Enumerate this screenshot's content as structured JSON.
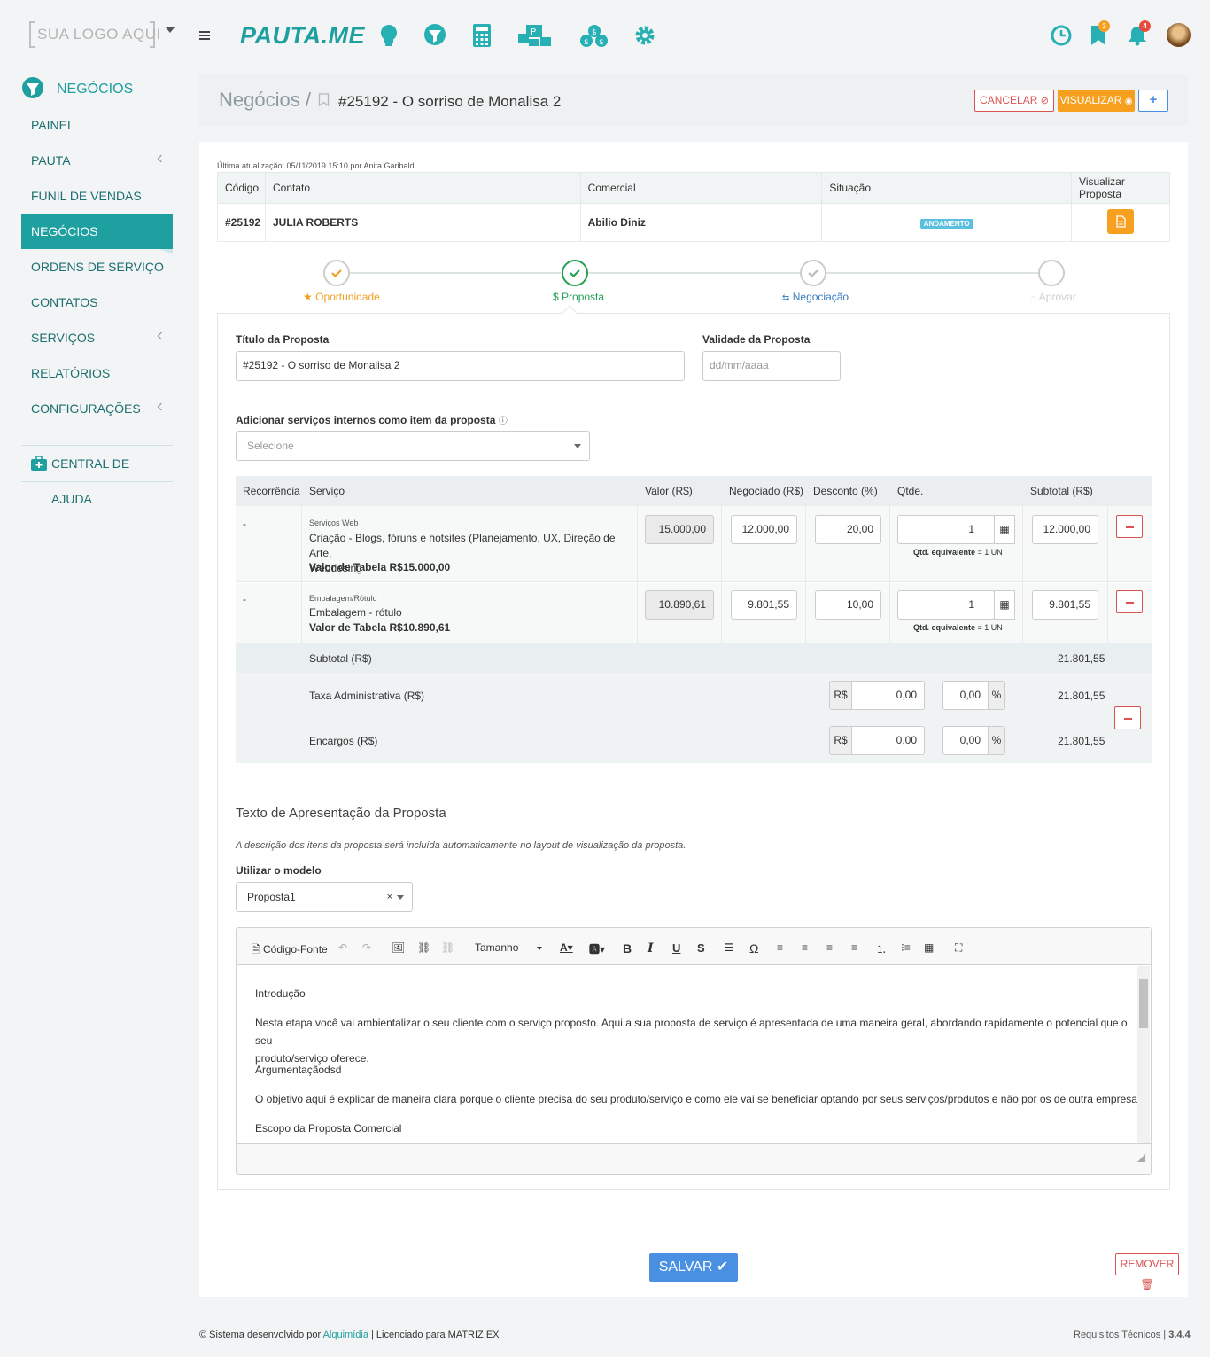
{
  "topbar": {
    "logo_placeholder": "SUA LOGO AQUI",
    "brand": "PAUTA.ME",
    "badges": {
      "bookmarks": "3",
      "notifications": "4"
    },
    "icons": [
      "lightbulb-icon",
      "funnel-icon",
      "calculator-icon",
      "board-icon",
      "coins-icon",
      "gear-icon",
      "clock-icon",
      "bookmark-icon",
      "bell-icon",
      "avatar"
    ]
  },
  "sidebar": {
    "section": "NEGÓCIOS",
    "items": [
      {
        "label": "PAINEL"
      },
      {
        "label": "PAUTA"
      },
      {
        "label": "FUNIL DE VENDAS"
      },
      {
        "label": "NEGÓCIOS"
      },
      {
        "label": "ORDENS DE SERVIÇO"
      },
      {
        "label": "CONTATOS"
      },
      {
        "label": "SERVIÇOS"
      },
      {
        "label": "RELATÓRIOS"
      },
      {
        "label": "CONFIGURAÇÕES"
      }
    ],
    "help": "CENTRAL DE AJUDA"
  },
  "header": {
    "crumb": "Negócios /",
    "title": "#25192 - O sorriso de Monalisa 2",
    "cancel": "CANCELAR",
    "view": "VISUALIZAR",
    "add": "+"
  },
  "info": {
    "updated": "Última atualização: 05/11/2019 15:10 por Anita Garibaldi",
    "headers": [
      "Código",
      "Contato",
      "Comercial",
      "Situação",
      "Visualizar Proposta"
    ],
    "code": "#25192",
    "contact": "JULIA ROBERTS",
    "commercial": "Abilio Diniz",
    "status": "ANDAMENTO"
  },
  "steps": [
    {
      "label": "Oportunidade",
      "color": "#f0a020"
    },
    {
      "label": "Proposta",
      "color": "#25a055"
    },
    {
      "label": "Negociação",
      "color": "#3a7bbf"
    },
    {
      "label": "Aprovar",
      "color": "#c8c8c8"
    }
  ],
  "form": {
    "title_label": "Título da Proposta",
    "title_value": "#25192 - O sorriso de Monalisa 2",
    "validity_label": "Validade da Proposta",
    "validity_placeholder": "dd/mm/aaaa",
    "add_services_label": "Adicionar serviços internos como item da proposta",
    "select_placeholder": "Selecione"
  },
  "services": {
    "headers": [
      "Recorrência",
      "Serviço",
      "Valor (R$)",
      "Negociado (R$)",
      "Desconto (%)",
      "Qtde.",
      "Subtotal (R$)"
    ],
    "rows": [
      {
        "recurrence": "-",
        "category": "Serviços Web",
        "name": "Criação - Blogs, fóruns e hotsites (Planejamento, UX, Direção de Arte,",
        "name2": "Webdesing",
        "table_value": "Valor de Tabela R$15.000,00",
        "value": "15.000,00",
        "negotiated": "12.000,00",
        "discount": "20,00",
        "qty": "1",
        "qty_eq_label": "Qtd. equivalente",
        "qty_eq": "= 1 UN",
        "subtotal": "12.000,00"
      },
      {
        "recurrence": "-",
        "category": "Embalagem/Rótulo",
        "name": "Embalagem - rótulo",
        "name2": "",
        "table_value": "Valor de Tabela R$10.890,61",
        "value": "10.890,61",
        "negotiated": "9.801,55",
        "discount": "10,00",
        "qty": "1",
        "qty_eq_label": "Qtd. equivalente",
        "qty_eq": "= 1 UN",
        "subtotal": "9.801,55"
      }
    ],
    "subtotal_label": "Subtotal (R$)",
    "subtotal": "21.801,55",
    "tax_label": "Taxa Administrativa (R$)",
    "tax_currency": "R$",
    "tax_value": "0,00",
    "tax_pct": "0,00",
    "tax_total": "21.801,55",
    "charges_label": "Encargos (R$)",
    "charges_currency": "R$",
    "charges_value": "0,00",
    "charges_pct": "0,00",
    "charges_total": "21.801,55",
    "pct_symbol": "%"
  },
  "presentation": {
    "heading": "Texto de Apresentação da Proposta",
    "note": "A descrição dos itens da proposta será incluída automaticamente no layout de visualização da proposta.",
    "model_label": "Utilizar o modelo",
    "model_value": "Proposta1",
    "toolbar": {
      "source": "Código-Fonte",
      "size": "Tamanho"
    },
    "content": [
      "Introdução",
      "Nesta etapa você vai ambientalizar o seu cliente com o serviço proposto. Aqui a sua proposta de serviço é apresentada de uma maneira geral, abordando rapidamente o potencial que o seu",
      "produto/serviço oferece.",
      "Argumentaçãodsd",
      "O objetivo aqui é explicar de maneira clara porque o cliente precisa do seu produto/serviço e como ele vai se beneficiar optando por seus serviços/produtos e não por os de outra empresa.",
      "Escopo da Proposta Comercial"
    ]
  },
  "actions": {
    "save": "SALVAR",
    "remove": "REMOVER"
  },
  "footer": {
    "left_prefix": "© Sistema desenvolvido por",
    "left_link": "Alquimídia",
    "left_suffix": "| Licenciado para MATRIZ EX",
    "right_prefix": "Requisitos Técnicos |",
    "version": "3.4.4"
  },
  "colors": {
    "accent": "#1e9fa0",
    "orange": "#f7a01f",
    "danger": "#d9534f",
    "primary": "#4a90e2"
  }
}
